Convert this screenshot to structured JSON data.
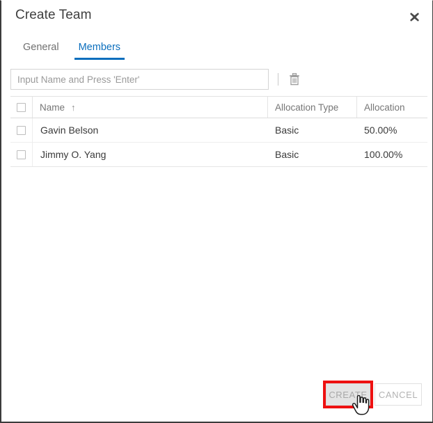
{
  "dialog": {
    "title": "Create Team",
    "close_icon": "close-icon"
  },
  "tabs": [
    {
      "label": "General",
      "active": false
    },
    {
      "label": "Members",
      "active": true
    }
  ],
  "toolbar": {
    "name_input_placeholder": "Input Name and Press 'Enter'",
    "name_input_value": "",
    "delete_icon": "trash-icon"
  },
  "table": {
    "sort_column": "Name",
    "sort_direction_glyph": "↑",
    "columns": [
      {
        "key": "check",
        "label": ""
      },
      {
        "key": "name",
        "label": "Name"
      },
      {
        "key": "type",
        "label": "Allocation Type"
      },
      {
        "key": "allocation",
        "label": "Allocation"
      }
    ],
    "rows": [
      {
        "name": "Gavin Belson",
        "type": "Basic",
        "allocation": "50.00%"
      },
      {
        "name": "Jimmy O. Yang",
        "type": "Basic",
        "allocation": "100.00%"
      }
    ]
  },
  "footer": {
    "create_label": "CREATE",
    "cancel_label": "CANCEL"
  },
  "annotation": {
    "highlight_color": "#ee1111",
    "cursor": "hand-pointer-cursor"
  }
}
